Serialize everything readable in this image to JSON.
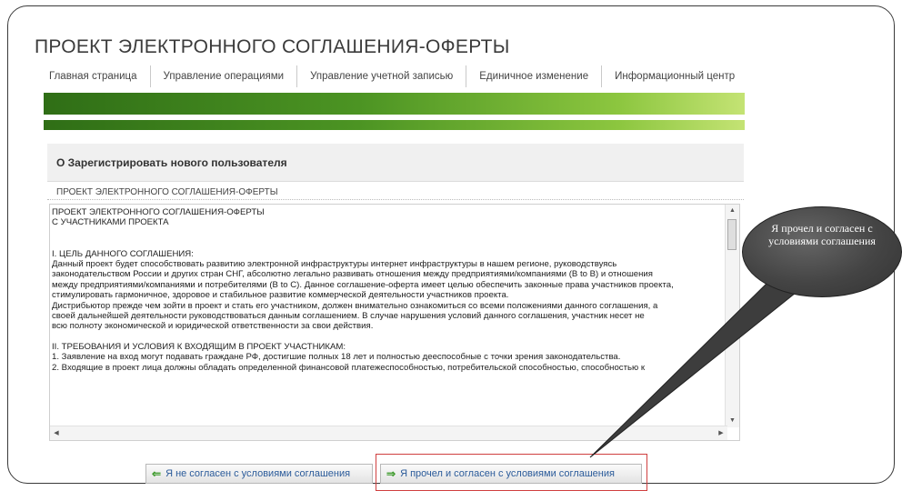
{
  "slide": {
    "title": "ПРОЕКТ ЭЛЕКТРОННОГО СОГЛАШЕНИЯ-ОФЕРТЫ"
  },
  "nav": {
    "items": [
      "Главная страница",
      "Управление операциями",
      "Управление учетной записью",
      "Единичное изменение",
      "Информационный центр"
    ]
  },
  "registration": {
    "label": "О Зарегистрировать нового пользователя"
  },
  "document": {
    "subheader": "ПРОЕКТ ЭЛЕКТРОННОГО СОГЛАШЕНИЯ-ОФЕРТЫ",
    "lines": [
      "ПРОЕКТ ЭЛЕКТРОННОГО СОГЛАШЕНИЯ-ОФЕРТЫ",
      "С УЧАСТНИКАМИ ПРОЕКТА",
      "",
      "",
      "I. ЦЕЛЬ ДАННОГО СОГЛАШЕНИЯ:",
      "Данный проект будет способствовать развитию электронной инфраструктуры интернет инфраструктуры в нашем регионе, руководствуясь",
      "законодательством России и других стран СНГ, абсолютно легально развивать отношения между предприятиями/компаниями (B to B) и отношения",
      "между предприятиями/компаниями и потребителями (B to C). Данное соглашение-оферта имеет целью обеспечить законные права участников проекта,",
      "стимулировать гармоничное, здоровое и стабильное развитие коммерческой деятельности участников проекта.",
      "Дистрибьютор прежде чем зойти в проект и стать его участником, должен внимательно ознакомиться со всеми положениями данного соглашения, а",
      "своей дальнейшей деятельности руководствоваться данным соглашением. В случае нарушения условий данного соглашения, участник несет не",
      "всю полноту экономической и юридической ответственности за свои действия.",
      "",
      "II. ТРЕБОВАНИЯ И УСЛОВИЯ К ВХОДЯЩИМ В ПРОЕКТ УЧАСТНИКАМ:",
      "1. Заявление на вход могут подавать граждане РФ, достигшие полных 18 лет и полностью дееспособные с точки зрения законодательства.",
      "2. Входящие в проект лица должны обладать определенной финансовой платежеспособностью, потребительской способностью, способностью к"
    ]
  },
  "buttons": {
    "decline": "Я не согласен с условиями соглашения",
    "accept": "Я прочел и согласен с условиями соглашения"
  },
  "callout": {
    "text": "Я прочел и согласен с условиями соглашения"
  },
  "colors": {
    "green_dark": "#2f6e16",
    "green_light": "#c4e374",
    "highlight_red": "#d04040",
    "link_blue": "#2b5b9a"
  }
}
